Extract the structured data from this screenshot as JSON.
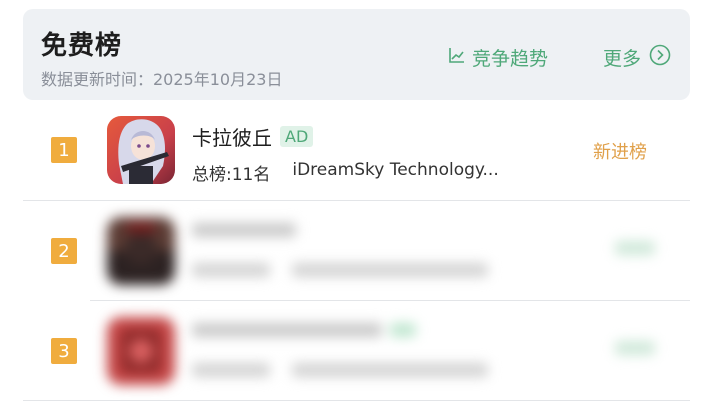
{
  "header": {
    "title": "免费榜",
    "update_time": "数据更新时间：2025年10月23日",
    "trend_label": "竞争趋势",
    "more_label": "更多",
    "trend_icon": "line-chart-icon",
    "more_icon": "chevron-right-circle-icon"
  },
  "rows": [
    {
      "rank": "1",
      "name": "卡拉彼丘",
      "ad_tag": "AD",
      "meta_rank": "总榜:11名",
      "developer": "iDreamSky Technology...",
      "status": "新进榜",
      "blurred": false
    },
    {
      "rank": "2",
      "blurred": true
    },
    {
      "rank": "3",
      "blurred": true
    }
  ],
  "colors": {
    "accent_green": "#4fa879",
    "rank_orange": "#f0ac3e",
    "status_orange": "#e0a04a",
    "header_bg": "#eef1f4"
  }
}
